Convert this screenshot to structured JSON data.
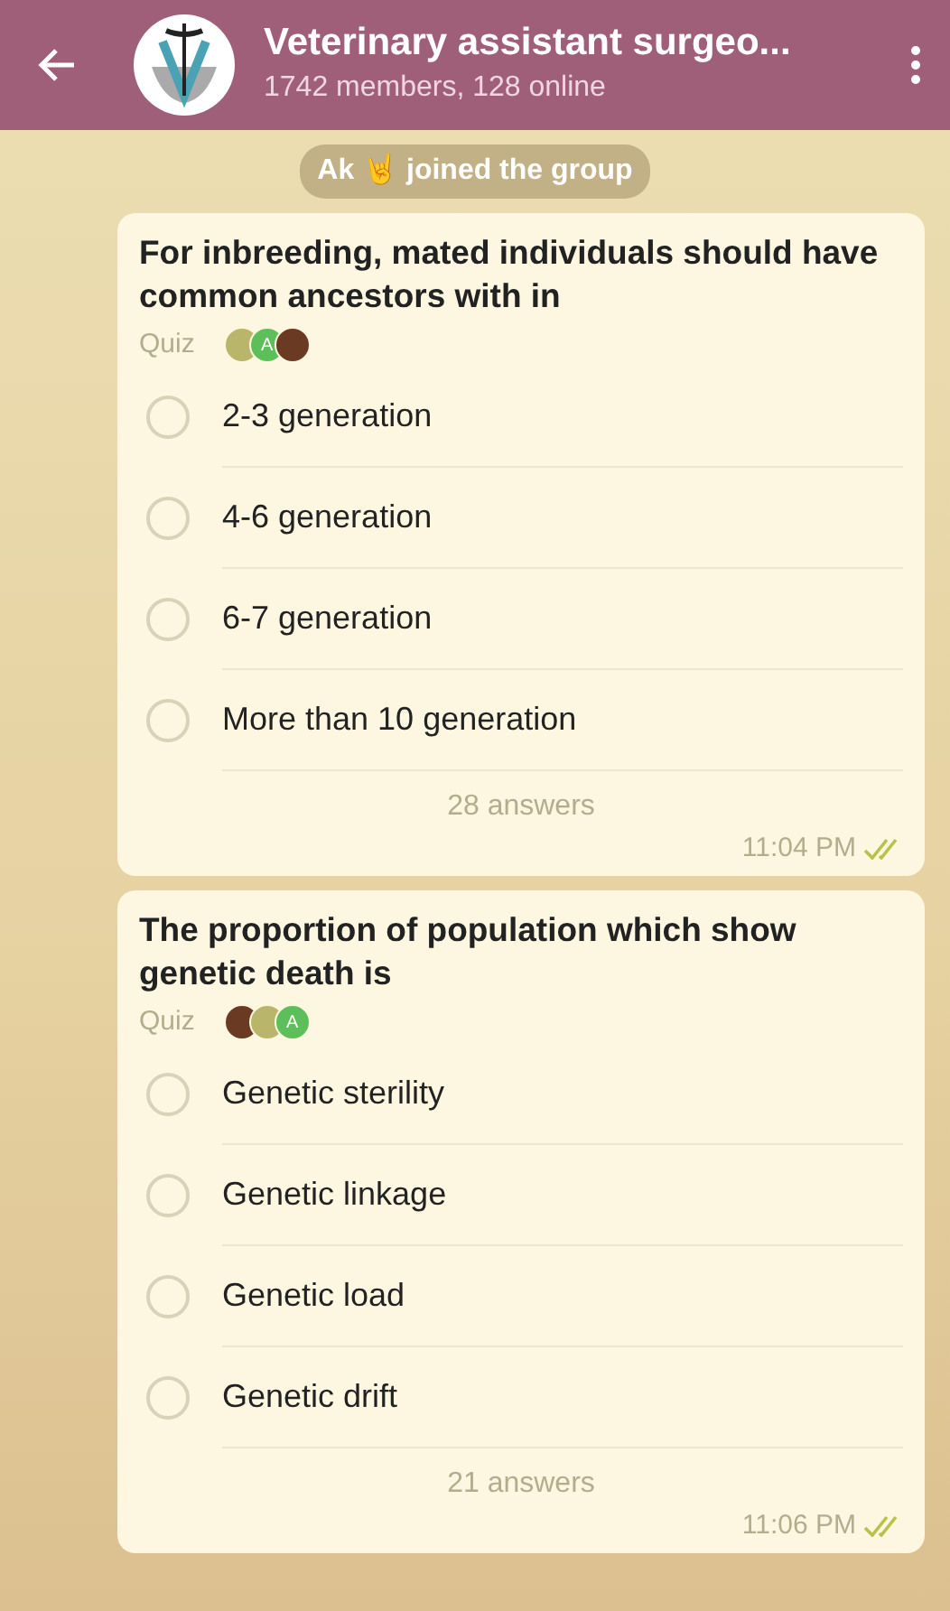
{
  "header": {
    "title": "Veterinary assistant surgeo...",
    "subtitle": "1742 members, 128 online"
  },
  "service_message": "Ak 🤘 joined the group",
  "polls": [
    {
      "question": "For inbreeding,  mated individuals should have common ancestors with in",
      "type_label": "Quiz",
      "voters": [
        {
          "kind": "photo",
          "color": "#b9b56a"
        },
        {
          "kind": "letter",
          "letter": "A",
          "color": "#5cbf5a"
        },
        {
          "kind": "photo",
          "color": "#6b3a22"
        }
      ],
      "options": [
        {
          "label": "2-3 generation",
          "selected": false
        },
        {
          "label": "4-6 generation",
          "selected": false
        },
        {
          "label": "6-7 generation",
          "selected": false
        },
        {
          "label": "More than 10 generation",
          "selected": false
        }
      ],
      "answers": "28 answers",
      "time": "11:04 PM",
      "read": true
    },
    {
      "question": "The proportion of population which show genetic death is",
      "type_label": "Quiz",
      "voters": [
        {
          "kind": "photo",
          "color": "#6b3a22"
        },
        {
          "kind": "photo",
          "color": "#b9b56a"
        },
        {
          "kind": "letter",
          "letter": "A",
          "color": "#5cbf5a"
        }
      ],
      "options": [
        {
          "label": "Genetic sterility",
          "selected": false
        },
        {
          "label": "Genetic linkage",
          "selected": false
        },
        {
          "label": "Genetic load",
          "selected": false
        },
        {
          "label": "Genetic drift",
          "selected": false
        }
      ],
      "answers": "21 answers",
      "time": "11:06 PM",
      "read": true
    }
  ]
}
